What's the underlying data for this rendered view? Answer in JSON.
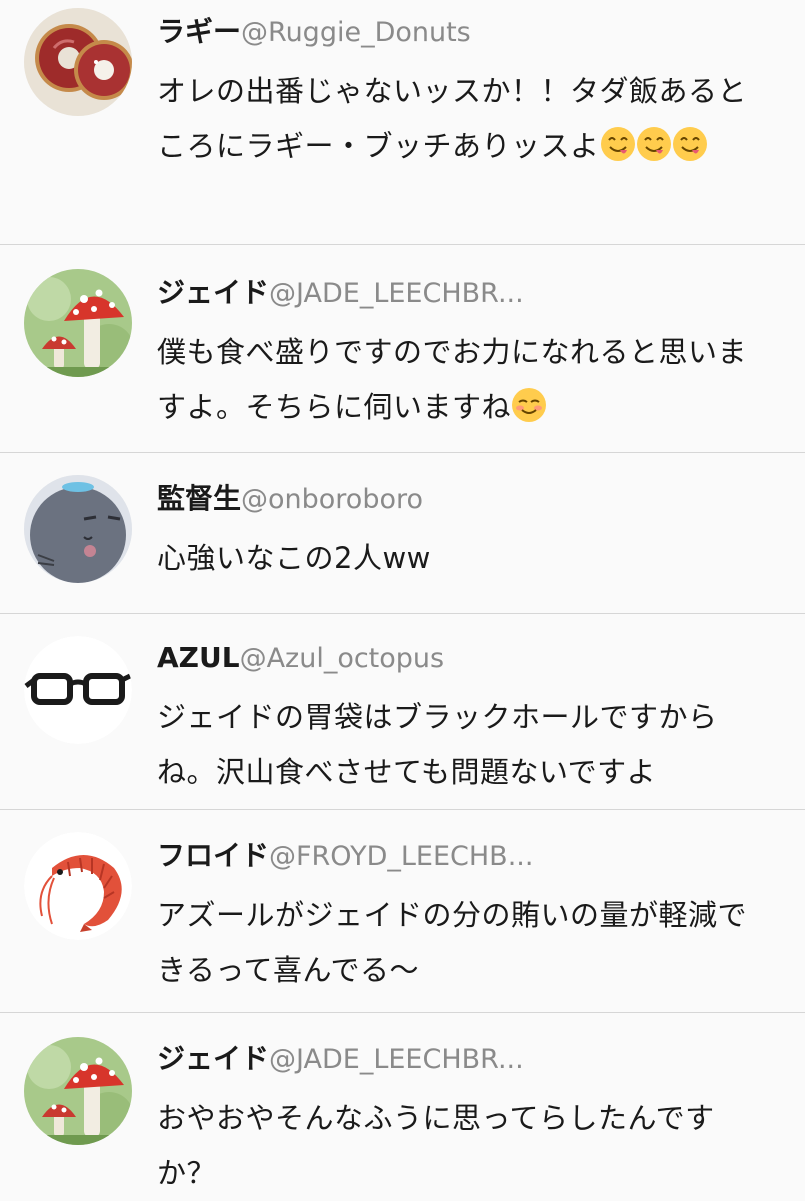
{
  "feed": {
    "tweets": [
      {
        "name": "ラギー",
        "handle": "@Ruggie_Donuts",
        "text": "オレの出番じゃないッスか！！タダ飯あるところにラギー・ブッチありッスよ",
        "avatar_icon": "donut-avatar",
        "emojis": [
          "yum-face-emoji",
          "yum-face-emoji",
          "yum-face-emoji"
        ]
      },
      {
        "name": "ジェイド",
        "handle": "@JADE_LEECHBR...",
        "text": "僕も食べ盛りですのでお力になれると思いますよ。そちらに伺いますね",
        "avatar_icon": "mushroom-avatar",
        "emojis": [
          "smiling-face-emoji"
        ]
      },
      {
        "name": "監督生",
        "handle": "@onboroboro",
        "text": "心強いなこの2人ww",
        "avatar_icon": "ghost-cat-avatar",
        "emojis": []
      },
      {
        "name": "AZUL",
        "handle": "@Azul_octopus",
        "text": "ジェイドの胃袋はブラックホールですからね。沢山食べさせても問題ないですよ",
        "avatar_icon": "glasses-avatar",
        "emojis": []
      },
      {
        "name": "フロイド",
        "handle": "@FROYD_LEECHB...",
        "text": "アズールがジェイドの分の賄いの量が軽減できるって喜んでる〜",
        "avatar_icon": "shrimp-avatar",
        "emojis": []
      },
      {
        "name": "ジェイド",
        "handle": "@JADE_LEECHBR...",
        "text": "おやおやそんなふうに思ってらしたんですか？",
        "avatar_icon": "mushroom-avatar",
        "emojis": []
      }
    ]
  },
  "colors": {
    "background": "#fafafa",
    "divider": "#d6d6d6",
    "handle": "#8a8a8a",
    "name": "#1a1a1a"
  }
}
